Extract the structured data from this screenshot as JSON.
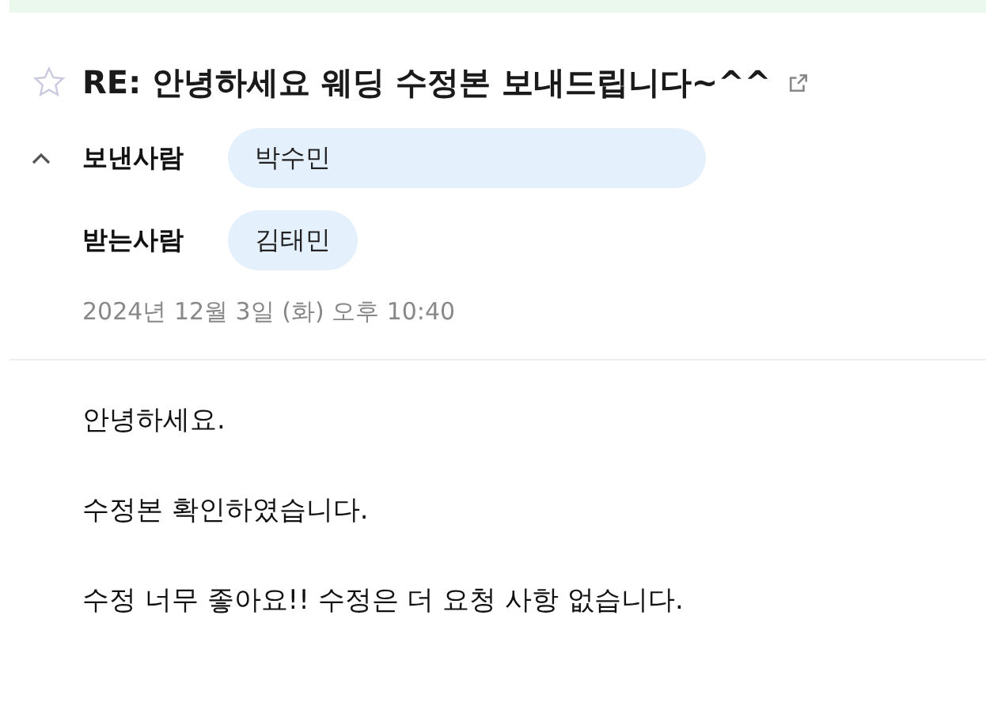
{
  "message": {
    "starred": false,
    "subject": "RE: 안녕하세요 웨딩 수정본 보내드립니다~^^",
    "headers_expanded": true,
    "fields": [
      {
        "label": "보낸사람",
        "chips": [
          {
            "name": "박수민",
            "wide": true
          }
        ]
      },
      {
        "label": "받는사람",
        "chips": [
          {
            "name": "김태민",
            "wide": false
          }
        ]
      }
    ],
    "date": "2024년 12월 3일 (화) 오후 10:40",
    "body": [
      "안녕하세요.",
      "수정본 확인하였습니다.",
      "수정 너무 좋아요!! 수정은 더 요청 사항 없습니다."
    ]
  }
}
